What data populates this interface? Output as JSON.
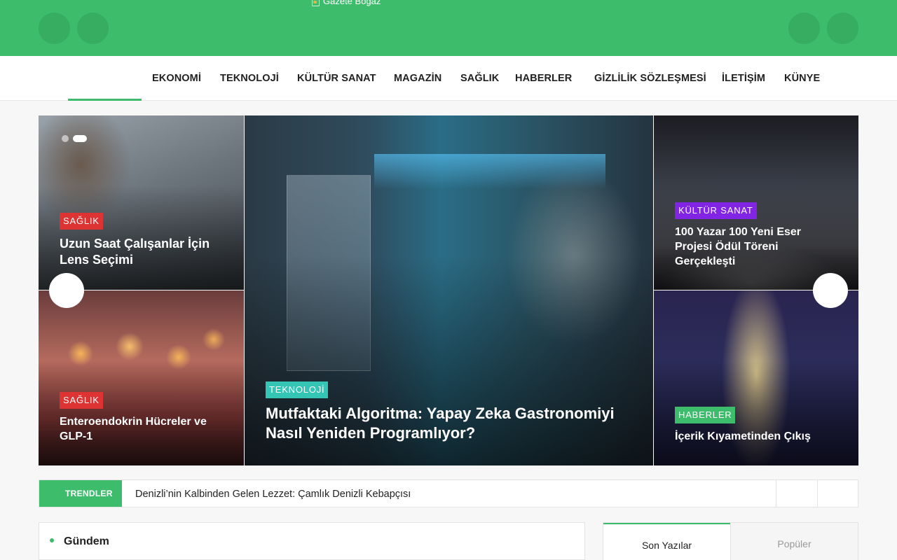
{
  "header": {
    "logo_alt": "Gazete Boğaz",
    "colors": {
      "brand": "#3dbd6c"
    }
  },
  "nav": {
    "items": [
      "EKONOMİ",
      "TEKNOLOJİ",
      "KÜLTÜR SANAT",
      "MAGAZİN",
      "SAĞLIK",
      "HABERLER",
      "GİZLİLİK SÖZLEŞMESİ",
      "İLETİŞİM",
      "KÜNYE"
    ]
  },
  "hero": {
    "cards": [
      {
        "category": "SAĞLIK",
        "category_color": "#dd3333",
        "title": "Uzun Saat Çalışanlar İçin Lens Seçimi"
      },
      {
        "category": "SAĞLIK",
        "category_color": "#dd3333",
        "title": "Enteroendokrin Hücreler ve GLP-1"
      },
      {
        "category": "TEKNOLOJİ",
        "category_color": "#35c5b5",
        "title": "Mutfaktaki Algoritma: Yapay Zeka Gastronomiyi Nasıl Yeniden Programlıyor?"
      },
      {
        "category": "KÜLTÜR SANAT",
        "category_color": "#8224e3",
        "title": "100 Yazar 100 Yeni Eser Projesi Ödül Töreni Gerçekleşti"
      },
      {
        "category": "HABERLER",
        "category_color": "#3dbd6c",
        "title": "İçerik Kıyametinden Çıkış"
      }
    ]
  },
  "trending": {
    "label": "TRENDLER",
    "headline": "Denizli’nin Kalbinden Gelen Lezzet: Çamlık Denizli Kebapçısı"
  },
  "gundem": {
    "title": "Gündem"
  },
  "tabs": {
    "recent": "Son Yazılar",
    "popular": "Popüler"
  }
}
